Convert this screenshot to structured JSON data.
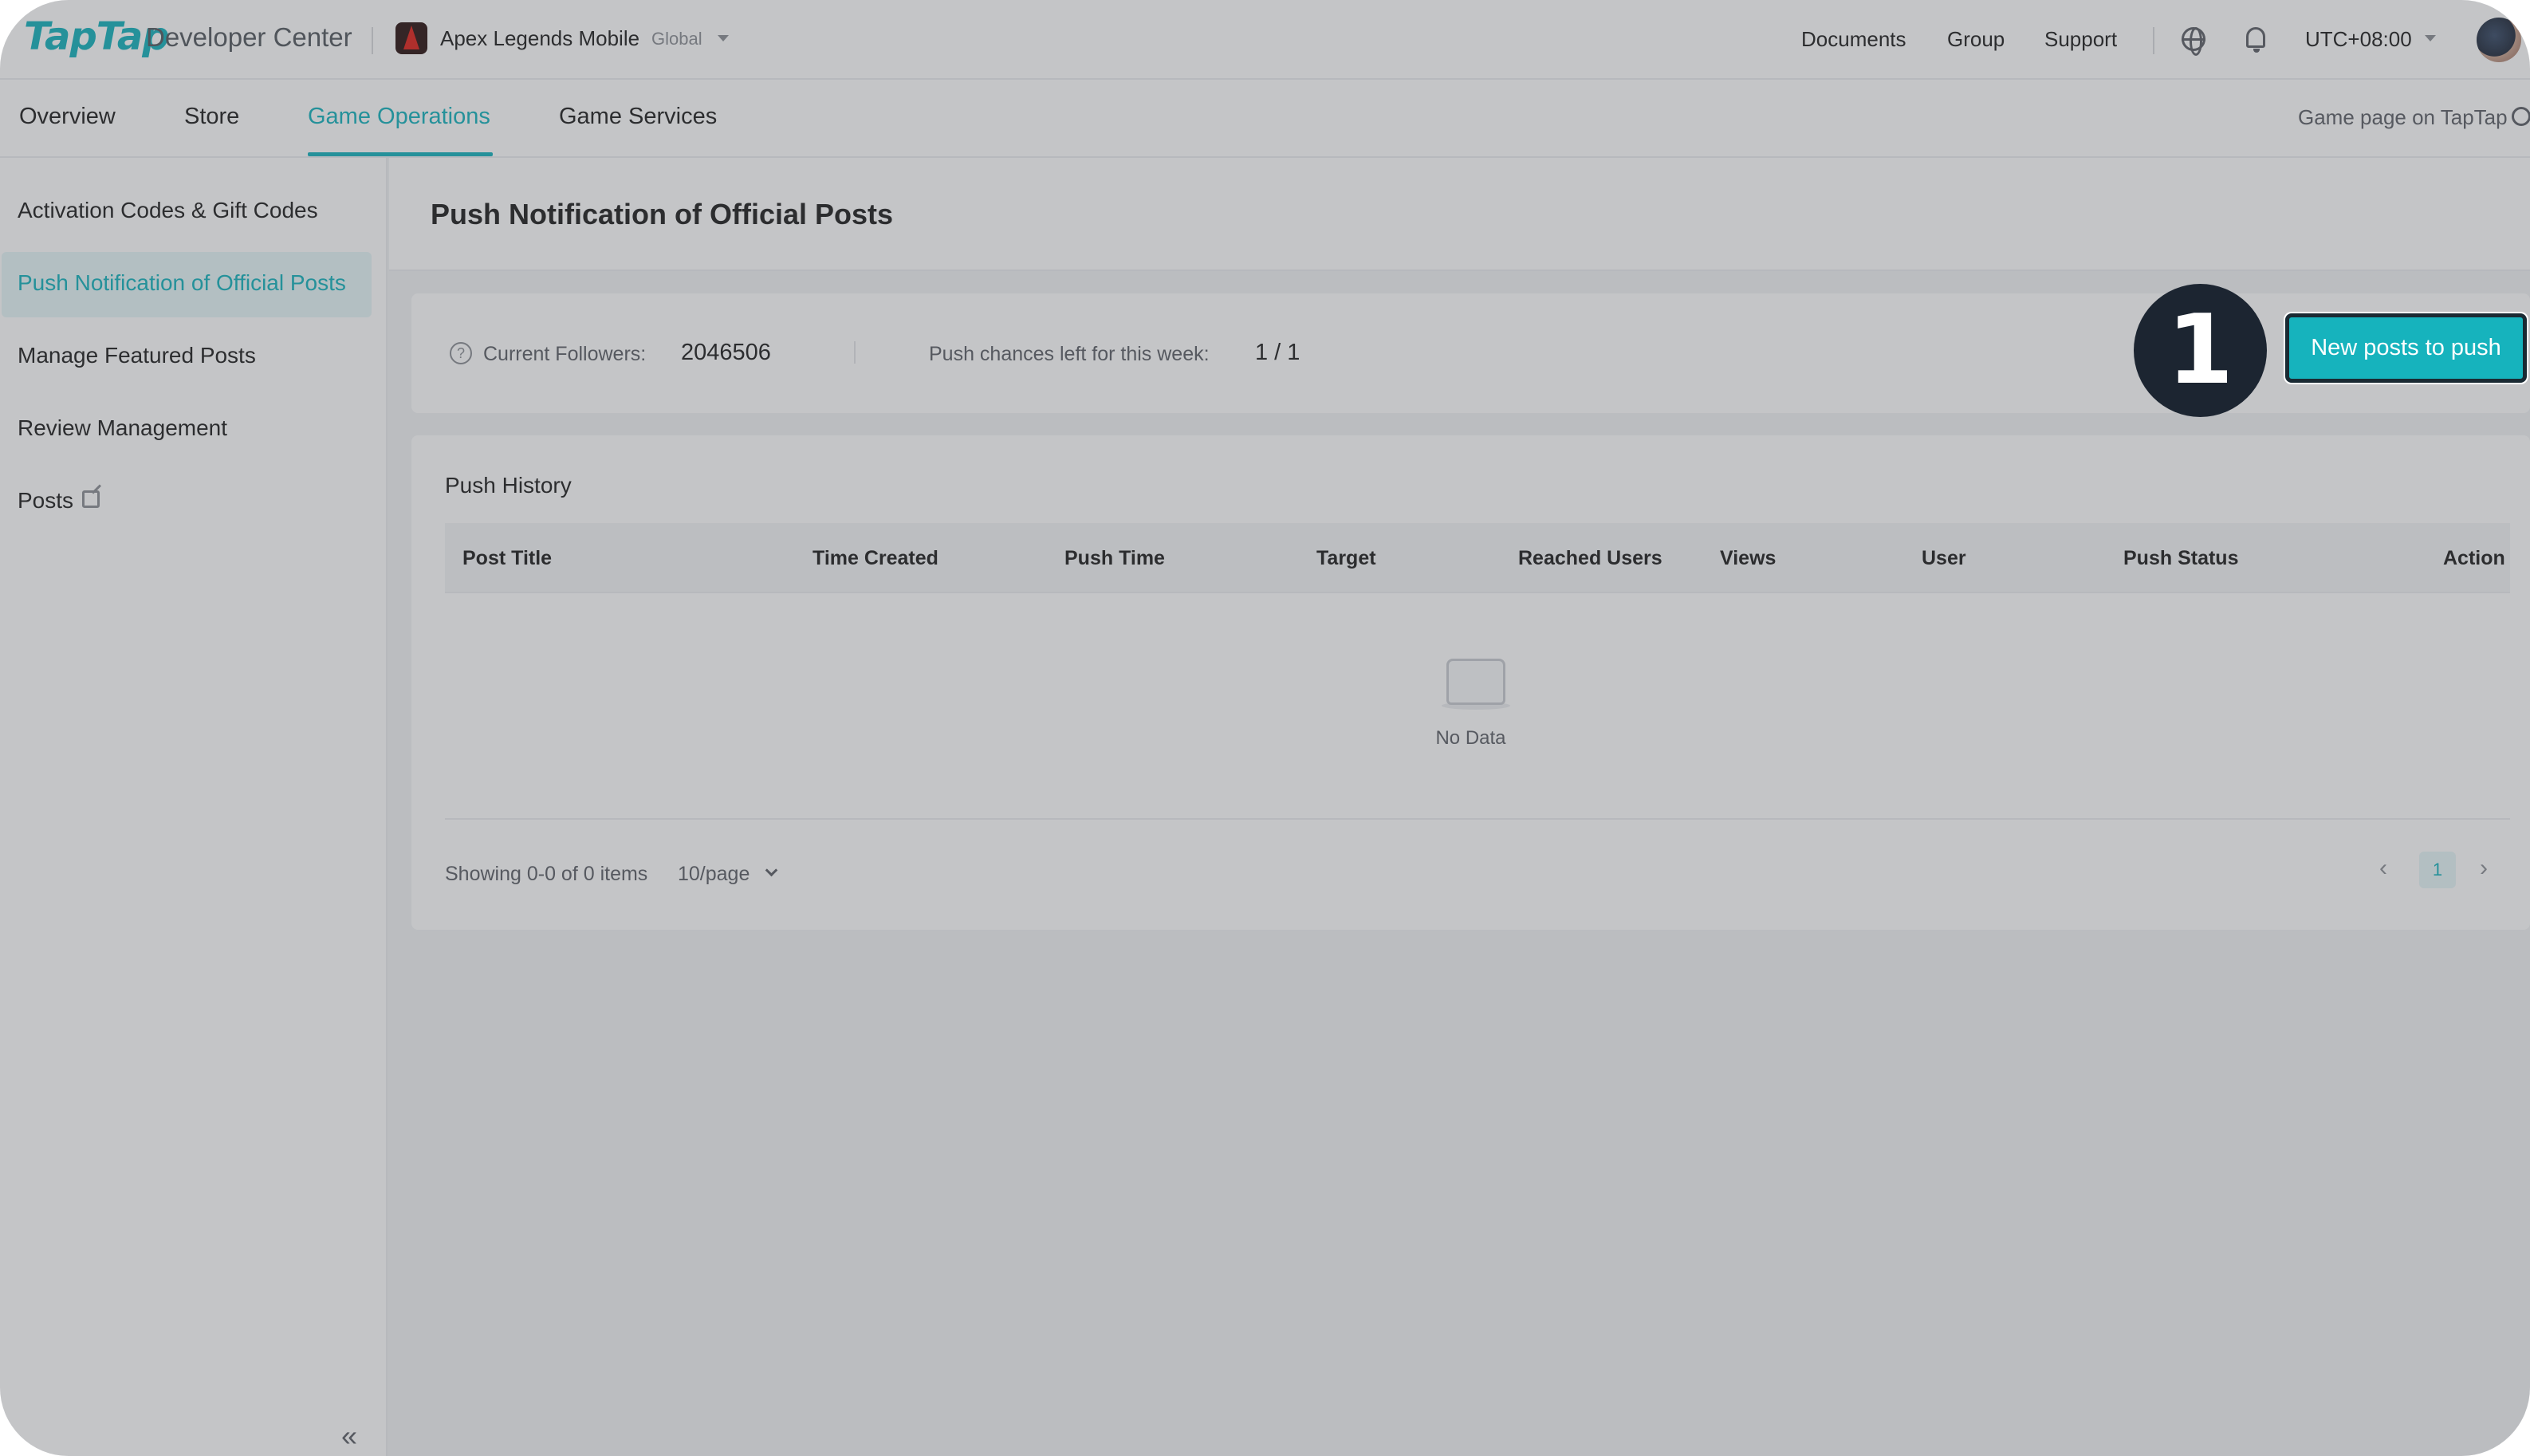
{
  "header": {
    "logo": "TapTap",
    "product": "Developer Center",
    "game_name": "Apex Legends Mobile",
    "game_region": "Global",
    "links": [
      "Documents",
      "Group",
      "Support"
    ],
    "timezone": "UTC+08:00"
  },
  "tabs": {
    "items": [
      {
        "label": "Overview"
      },
      {
        "label": "Store"
      },
      {
        "label": "Game Operations"
      },
      {
        "label": "Game Services"
      }
    ],
    "active": "Game Operations",
    "game_page_link": "Game page on TapTap"
  },
  "sidebar": {
    "items": [
      {
        "label": "Activation Codes & Gift Codes"
      },
      {
        "label": "Push Notification of Official Posts"
      },
      {
        "label": "Manage Featured Posts"
      },
      {
        "label": "Review Management"
      },
      {
        "label": "Posts"
      }
    ],
    "active": "Push Notification of Official Posts",
    "collapse_glyph": "«"
  },
  "page": {
    "title": "Push Notification of Official Posts"
  },
  "stats": {
    "help_glyph": "?",
    "followers_label": "Current Followers:",
    "followers_value": "2046506",
    "push_chances_label": "Push chances left for this week:",
    "push_chances_value": "1 / 1"
  },
  "actions": {
    "new_post_button": "New posts to push",
    "step_number": "1"
  },
  "history": {
    "title": "Push History",
    "columns": [
      "Post Title",
      "Time Created",
      "Push Time",
      "Target",
      "Reached Users",
      "Views",
      "User",
      "Push Status",
      "Action"
    ],
    "rows": [],
    "empty_text": "No Data"
  },
  "pagination": {
    "summary": "Showing 0-0 of 0 items",
    "page_size": "10/page",
    "current_page": "1",
    "prev_glyph": "‹",
    "next_glyph": "›"
  },
  "colors": {
    "accent": "#16b3bd",
    "badge": "#1c2531"
  },
  "icons": [
    "globe-icon",
    "bell-icon",
    "help-circle-icon",
    "external-link-icon",
    "inbox-empty-icon",
    "collapse-icon"
  ]
}
